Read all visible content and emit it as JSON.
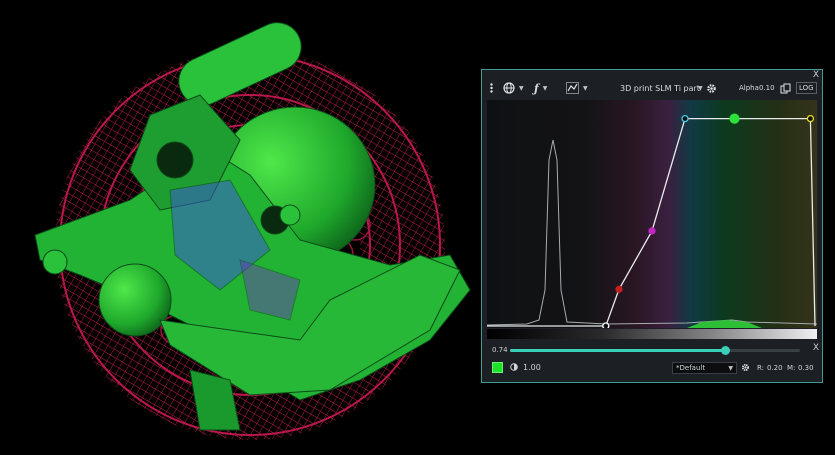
{
  "panel": {
    "close_top": "X",
    "close_bottom": "X",
    "dataset_name": "3D print SLM Ti part",
    "alpha_label": "Alpha",
    "alpha_value": "0.10",
    "log_button": "LOG"
  },
  "toolbar_icons": [
    "menu-icon",
    "globe-icon",
    "function-icon",
    "curve-icon",
    "gear-icon",
    "copy-icon"
  ],
  "transfer_function": {
    "control_points": [
      {
        "x": 0.36,
        "alpha": 0.0,
        "color": "#ffffff"
      },
      {
        "x": 0.4,
        "alpha": 0.17,
        "color": "#c22020"
      },
      {
        "x": 0.5,
        "alpha": 0.44,
        "color": "#c026c0"
      },
      {
        "x": 0.6,
        "alpha": 0.96,
        "color": "#3fd0e0"
      },
      {
        "x": 0.75,
        "alpha": 0.96,
        "color": "#2ee03a"
      },
      {
        "x": 0.98,
        "alpha": 0.96,
        "color": "#e6dc20"
      }
    ],
    "histogram_peak_x": 0.2
  },
  "opacity_slider": {
    "value": "0.74",
    "fraction": 0.74
  },
  "bottom": {
    "swatch_color": "#1ee12a",
    "brightness_value": "1.00",
    "preset": "*Default",
    "r_label": "R:",
    "r_value": "0.20",
    "m_label": "M:",
    "m_value": "0.30"
  }
}
